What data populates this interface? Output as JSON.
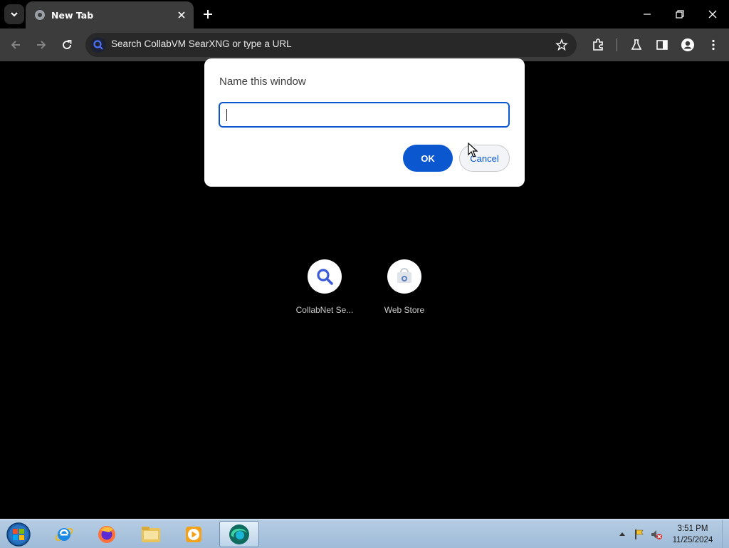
{
  "browser": {
    "tab": {
      "title": "New Tab"
    },
    "omnibox": {
      "placeholder": "Search CollabVM SearXNG or type a URL"
    }
  },
  "new_tab_page": {
    "shortcuts": [
      {
        "label": "CollabNet Se...",
        "icon": "search-icon"
      },
      {
        "label": "Web Store",
        "icon": "web-store-icon"
      }
    ]
  },
  "dialog": {
    "title": "Name this window",
    "input_value": "",
    "ok_label": "OK",
    "cancel_label": "Cancel"
  },
  "taskbar": {
    "apps": [
      "start-orb-icon",
      "internet-explorer-icon",
      "firefox-icon",
      "file-explorer-icon",
      "media-player-icon",
      "browser-icon"
    ],
    "clock": {
      "time": "3:51 PM",
      "date": "11/25/2024"
    }
  },
  "colors": {
    "accent": "#0b57d0",
    "toolbar": "#3c3c3c",
    "page_background": "#000000",
    "dialog_background": "#ffffff"
  }
}
